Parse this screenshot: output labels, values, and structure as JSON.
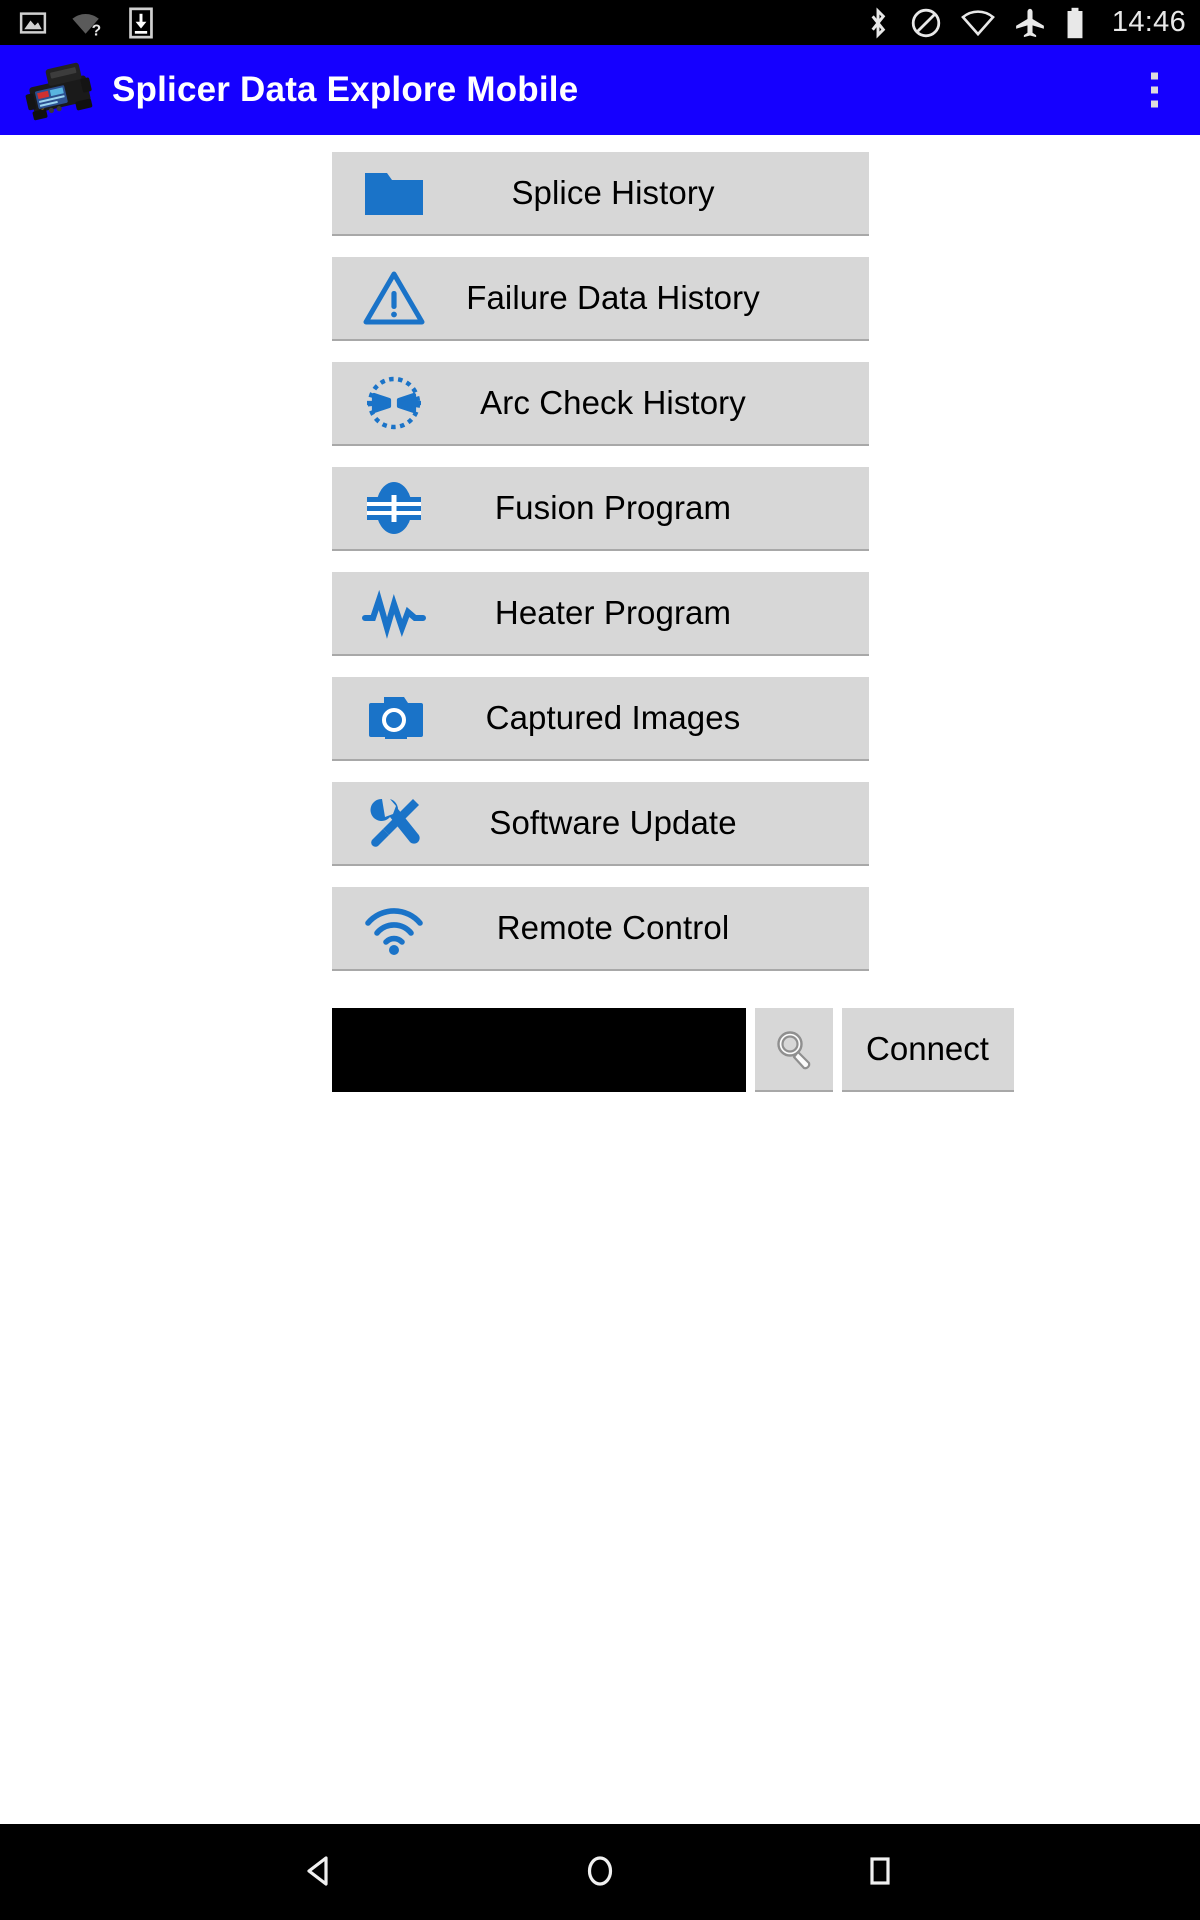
{
  "status_bar": {
    "left_icons": [
      {
        "name": "photo-icon",
        "label": "Screenshot"
      },
      {
        "name": "wifi-question-icon",
        "label": "Wi-Fi no internet"
      },
      {
        "name": "download-icon",
        "label": "Download"
      }
    ],
    "right_icons": [
      {
        "name": "bluetooth-icon",
        "label": "Bluetooth"
      },
      {
        "name": "do-not-disturb-icon",
        "label": "Do Not Disturb"
      },
      {
        "name": "wifi-icon",
        "label": "Wi-Fi"
      },
      {
        "name": "airplane-mode-icon",
        "label": "Airplane mode"
      },
      {
        "name": "battery-icon",
        "label": "Battery"
      }
    ],
    "time": "14:46"
  },
  "app_bar": {
    "title": "Splicer Data Explore Mobile",
    "logo_name": "splicer-device-logo",
    "overflow_menu_name": "overflow-menu-button",
    "background_color": "#1500ff",
    "title_color": "#ffffff"
  },
  "menu": {
    "items": [
      {
        "label": "Splice History",
        "icon": "folder-icon"
      },
      {
        "label": "Failure Data History",
        "icon": "warning-triangle-icon"
      },
      {
        "label": "Arc Check History",
        "icon": "arc-electrodes-icon"
      },
      {
        "label": "Fusion Program",
        "icon": "fusion-ellipse-icon"
      },
      {
        "label": "Heater Program",
        "icon": "waveform-icon"
      },
      {
        "label": "Captured Images",
        "icon": "camera-icon"
      },
      {
        "label": "Software Update",
        "icon": "tools-icon"
      },
      {
        "label": "Remote Control",
        "icon": "wifi-signal-icon"
      }
    ],
    "button_color": "#d7d7d7",
    "icon_color": "#1a73c8"
  },
  "connect_bar": {
    "ip_value": "",
    "ip_placeholder": "",
    "search_icon": "magnifier-icon",
    "connect_label": "Connect"
  },
  "nav_bar": {
    "back_icon": "back-triangle-icon",
    "home_icon": "home-circle-icon",
    "recents_icon": "recents-square-icon"
  }
}
